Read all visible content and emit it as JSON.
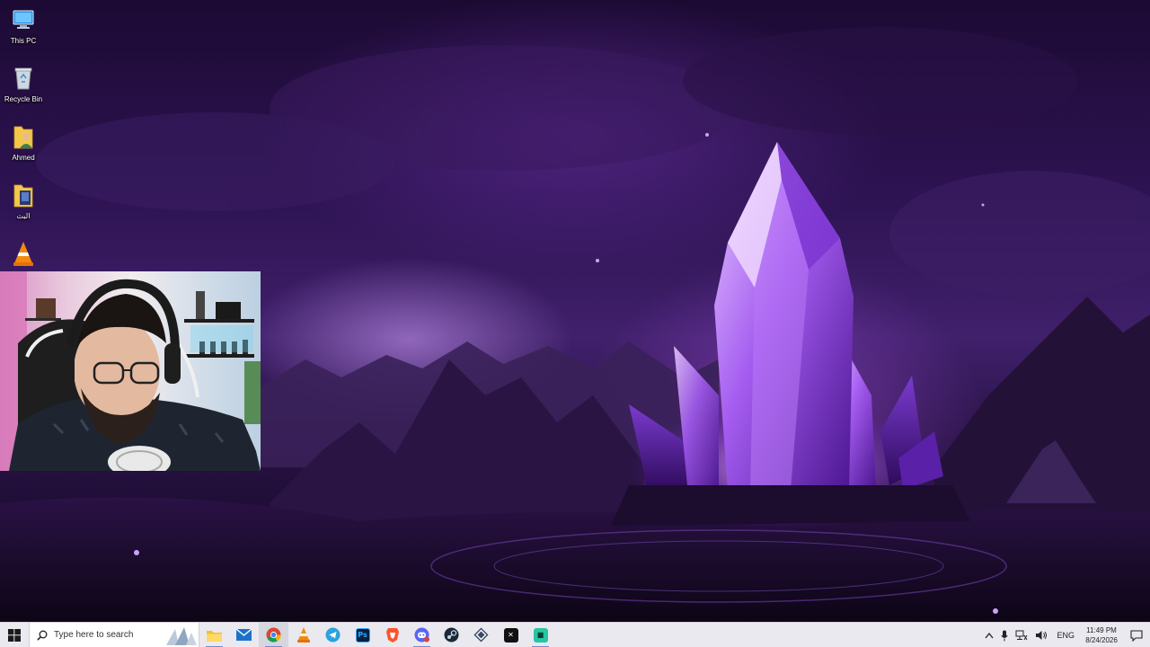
{
  "desktop": {
    "icons": [
      {
        "label": "This PC",
        "icon": "this-pc-icon"
      },
      {
        "label": "Recycle Bin",
        "icon": "recycle-bin-icon"
      },
      {
        "label": "Ahmed",
        "icon": "user-folder-icon"
      },
      {
        "label": "البث",
        "icon": "folder-icon"
      },
      {
        "label": "",
        "icon": "vlc-icon"
      }
    ]
  },
  "taskbar": {
    "search_placeholder": "Type here to search",
    "apps": [
      {
        "name": "File Explorer",
        "icon": "file-explorer-icon"
      },
      {
        "name": "Mail",
        "icon": "mail-icon"
      },
      {
        "name": "Google Chrome",
        "icon": "chrome-icon"
      },
      {
        "name": "VLC",
        "icon": "vlc-icon"
      },
      {
        "name": "Telegram",
        "icon": "telegram-icon"
      },
      {
        "name": "Photoshop",
        "icon": "photoshop-icon"
      },
      {
        "name": "Brave",
        "icon": "brave-icon"
      },
      {
        "name": "Discord",
        "icon": "discord-icon"
      },
      {
        "name": "Steam",
        "icon": "steam-icon"
      },
      {
        "name": "App",
        "icon": "diamond-app-icon"
      },
      {
        "name": "CapCut",
        "icon": "capcut-icon"
      },
      {
        "name": "App",
        "icon": "green-app-icon"
      }
    ],
    "tray": {
      "language": "ENG",
      "time": "11:49 PM",
      "date": "8/24/2026"
    }
  },
  "colors": {
    "taskbar_bg": "#e9e9ef",
    "wallpaper_accent": "#9b4dff",
    "chrome_active": "#d6d6de"
  }
}
